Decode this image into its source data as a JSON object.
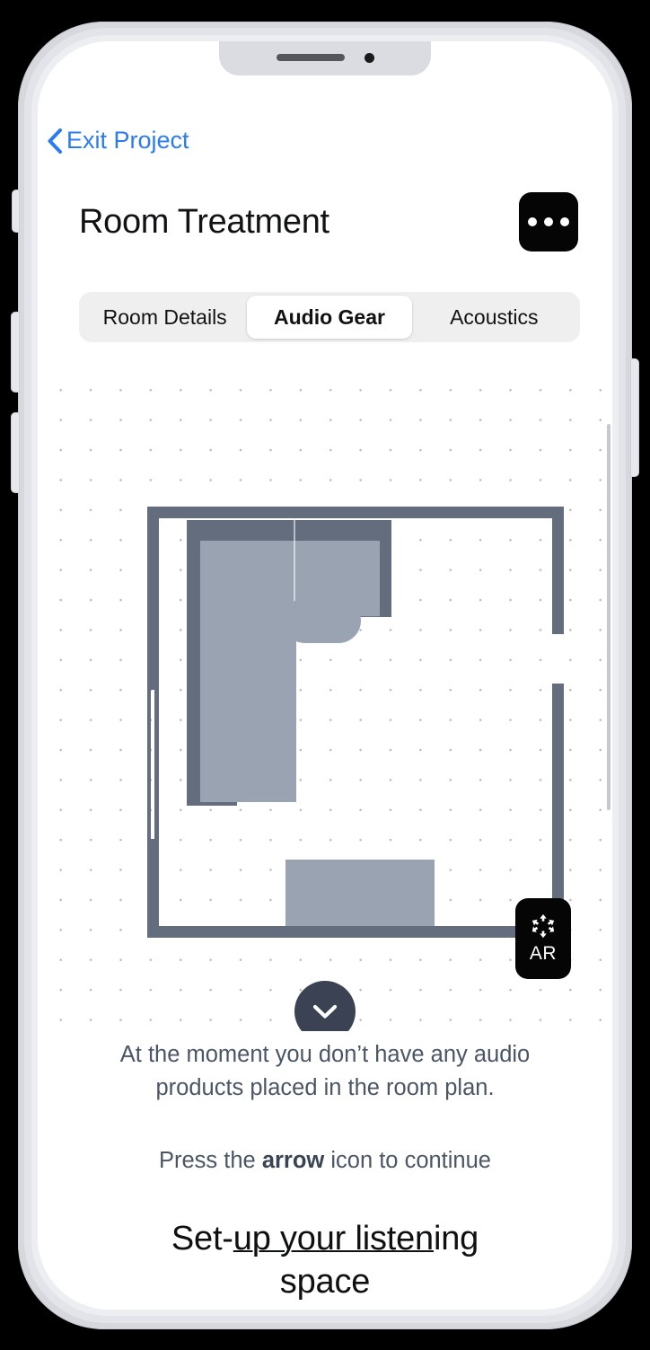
{
  "device": {
    "speaker_icon": "speaker-grille",
    "camera_icon": "front-camera",
    "buttons": [
      "silent-switch",
      "volume-up",
      "volume-down",
      "power"
    ]
  },
  "nav": {
    "back_label": "Exit Project",
    "back_icon": "chevron-left-icon",
    "back_color": "#2b7bf3"
  },
  "header": {
    "title": "Room Treatment",
    "more_icon": "ellipsis-icon",
    "more_label": "More options"
  },
  "tabs": {
    "items": [
      {
        "label": "Room Details",
        "active": false
      },
      {
        "label": "Audio Gear",
        "active": true
      },
      {
        "label": "Acoustics",
        "active": false
      }
    ],
    "active_index": 1,
    "track_color": "#efeff0",
    "active_pill_color": "#ffffff"
  },
  "plan": {
    "grid": {
      "dot_spacing_px": 33,
      "dot_color": "#b9bcc4"
    },
    "wall_color": "#646d7e",
    "furniture_frame_color": "#646d7e",
    "furniture_fill_color": "#9aa3b2",
    "items": [
      {
        "name": "sectional-sofa",
        "type": "furniture"
      },
      {
        "name": "coffee-table",
        "type": "furniture"
      },
      {
        "name": "media-unit",
        "type": "furniture"
      },
      {
        "name": "left-wall-window",
        "type": "opening"
      },
      {
        "name": "right-wall-door",
        "type": "opening"
      }
    ],
    "ar_button": {
      "label": "AR",
      "icon": "ar-cube-icon"
    },
    "expand_button": {
      "icon": "chevron-down-icon",
      "color": "#3a4254"
    },
    "scrollbar": {
      "visible": true,
      "color": "#c6c8cf"
    }
  },
  "body": {
    "empty_state": "At the moment you don’t have any audio products placed in the room plan.",
    "hint_prefix": "Press the ",
    "hint_bold": "arrow",
    "hint_suffix": " icon to continue"
  },
  "cta": {
    "line1_plain_start": "Set-",
    "line1_underlined": "up your listen",
    "line1_plain_end": "ing",
    "line2": "space"
  }
}
